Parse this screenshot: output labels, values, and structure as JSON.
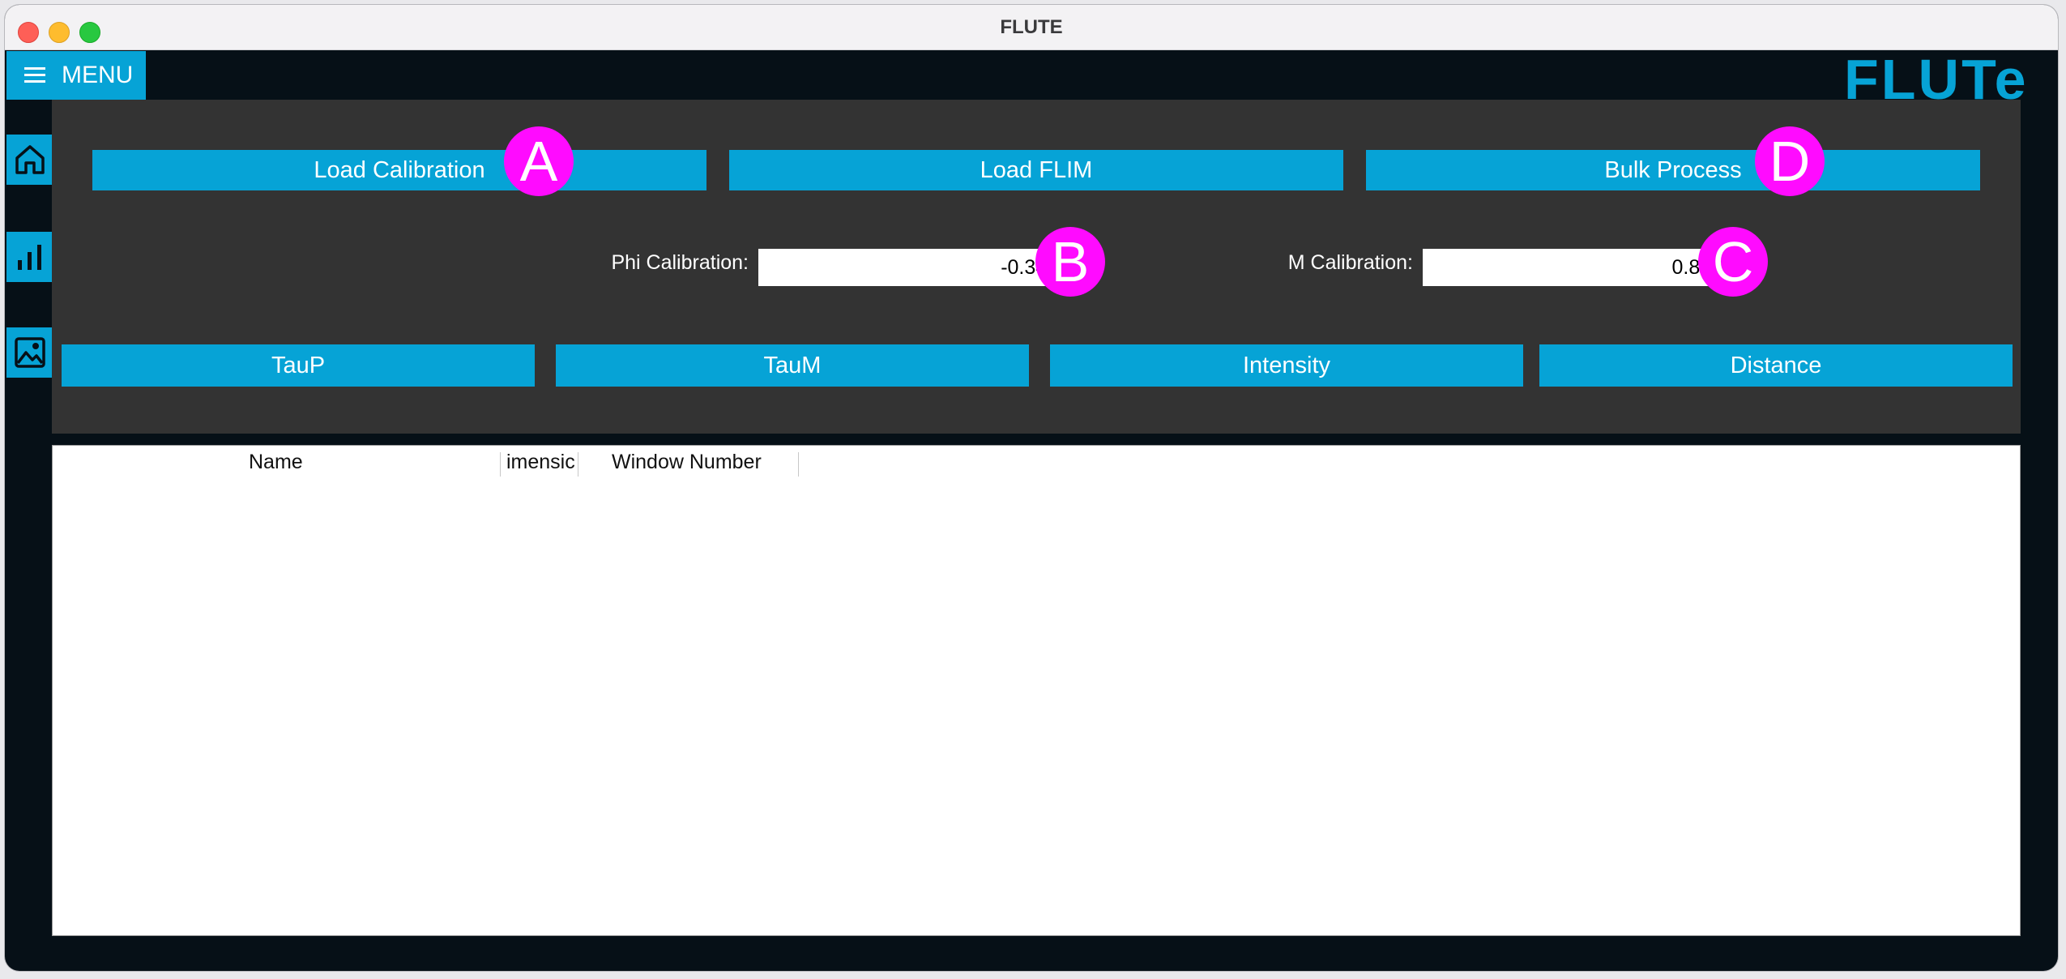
{
  "window": {
    "title": "FLUTE"
  },
  "menu": {
    "label": "MENU"
  },
  "logo": {
    "text": "FLUTe"
  },
  "buttons": {
    "load_calibration": "Load Calibration",
    "load_flim": "Load FLIM",
    "bulk_process": "Bulk Process"
  },
  "calibration": {
    "phi_label": "Phi Calibration:",
    "phi_value": "-0.3441",
    "m_label": "M Calibration:",
    "m_value": "0.8672"
  },
  "views": {
    "taup": "TauP",
    "taum": "TauM",
    "intensity": "Intensity",
    "distance": "Distance"
  },
  "table": {
    "columns": [
      "Name",
      "imensic",
      "Window Number"
    ]
  },
  "markers": {
    "a": "A",
    "b": "B",
    "c": "C",
    "d": "D"
  },
  "colors": {
    "accent": "#06a3d6",
    "panel": "#333333",
    "background": "#061017",
    "marker": "#ff0bff"
  },
  "icons": {
    "menu": "hamburger-icon",
    "home": "home-icon",
    "chart": "bar-chart-icon",
    "image": "image-icon"
  }
}
